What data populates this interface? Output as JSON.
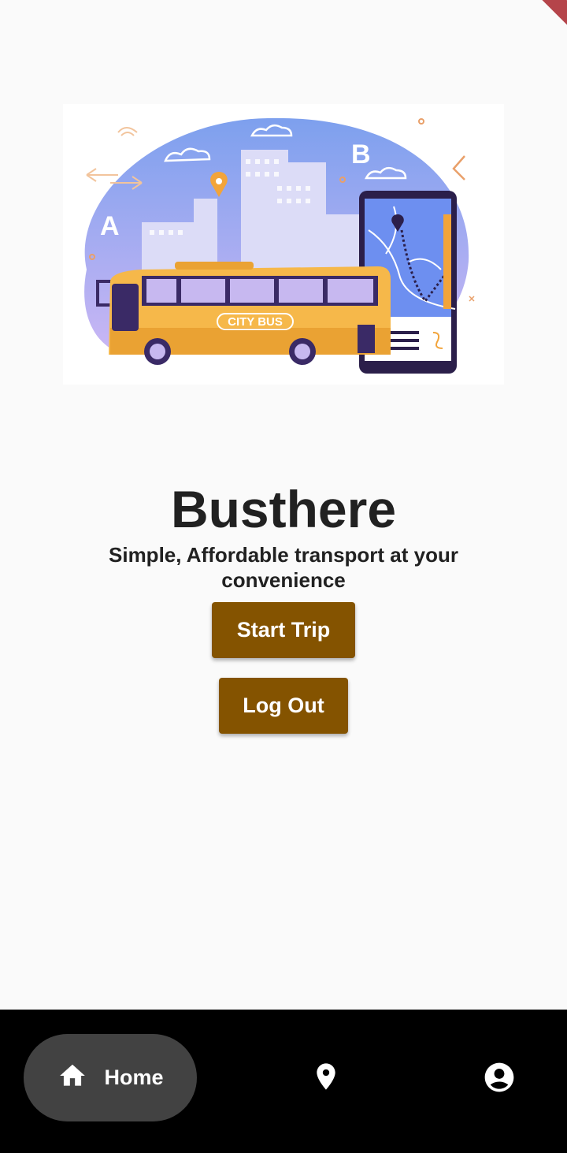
{
  "app": {
    "title": "Busthere",
    "subtitle": "Simple, Affordable transport at your convenience"
  },
  "hero": {
    "bus_label": "CITY BUS",
    "point_a": "A",
    "point_b": "B"
  },
  "buttons": {
    "start_trip": "Start Trip",
    "log_out": "Log Out"
  },
  "nav": {
    "items": [
      {
        "label": "Home",
        "icon": "home-icon",
        "selected": true
      },
      {
        "label": "",
        "icon": "location-pin-icon",
        "selected": false
      },
      {
        "label": "",
        "icon": "account-circle-icon",
        "selected": false
      }
    ]
  },
  "colors": {
    "background": "#fafafa",
    "button": "#845300",
    "text": "#212121",
    "navbar": "#000000",
    "nav_selected": "#424242",
    "debug_banner": "#b5444a"
  }
}
